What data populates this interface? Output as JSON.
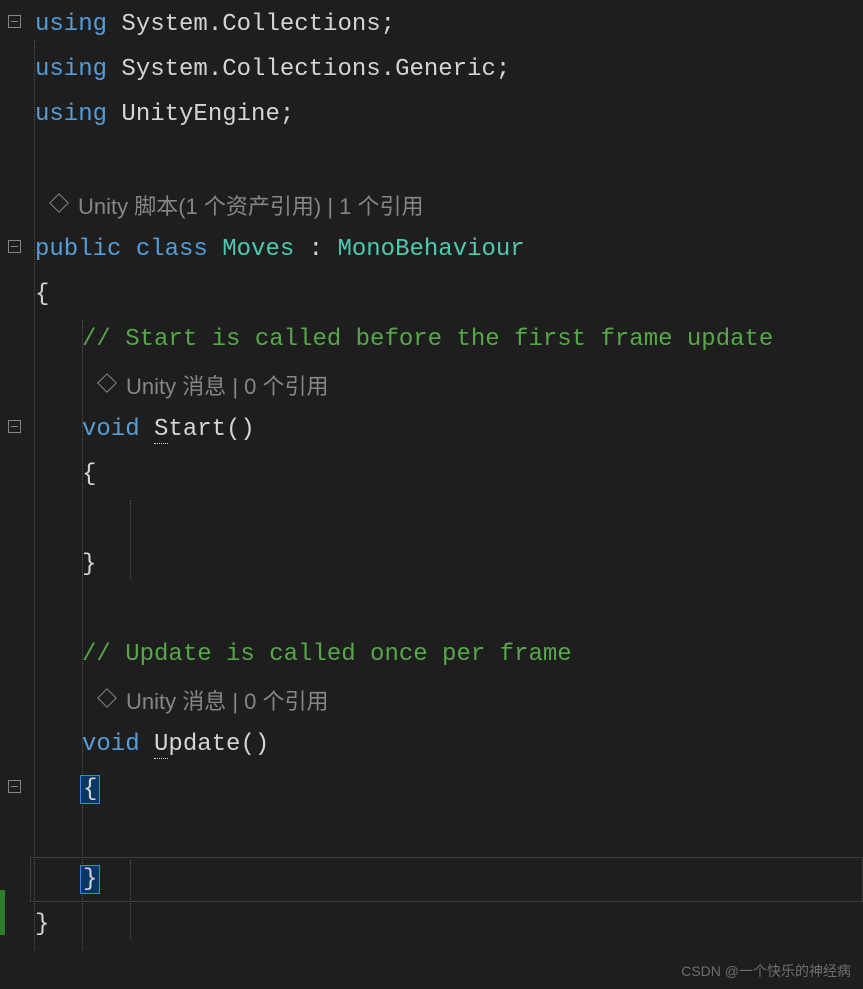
{
  "code": {
    "using1": {
      "kw": "using",
      "ns": " System.Collections;"
    },
    "using2": {
      "kw": "using",
      "ns": " System.Collections.Generic;"
    },
    "using3": {
      "kw": "using",
      "ns": " UnityEngine;"
    },
    "classLens": "Unity 脚本(1 个资产引用) | 1 个引用",
    "classDecl": {
      "mod": "public class",
      "name": " Moves",
      "colon": " : ",
      "base": "MonoBehaviour"
    },
    "braceOpen": "{",
    "braceClose": "}",
    "comment1": "// Start is called before the first frame update",
    "startLens": "Unity 消息 | 0 个引用",
    "startDecl": {
      "kw": "void",
      "name": " Start",
      "paren": "()"
    },
    "comment2": "// Update is called once per frame",
    "updateLens": "Unity 消息 | 0 个引用",
    "updateDecl": {
      "kw": "void",
      "name": " Update",
      "paren": "()"
    }
  },
  "watermark": "CSDN @一个快乐的神经病"
}
